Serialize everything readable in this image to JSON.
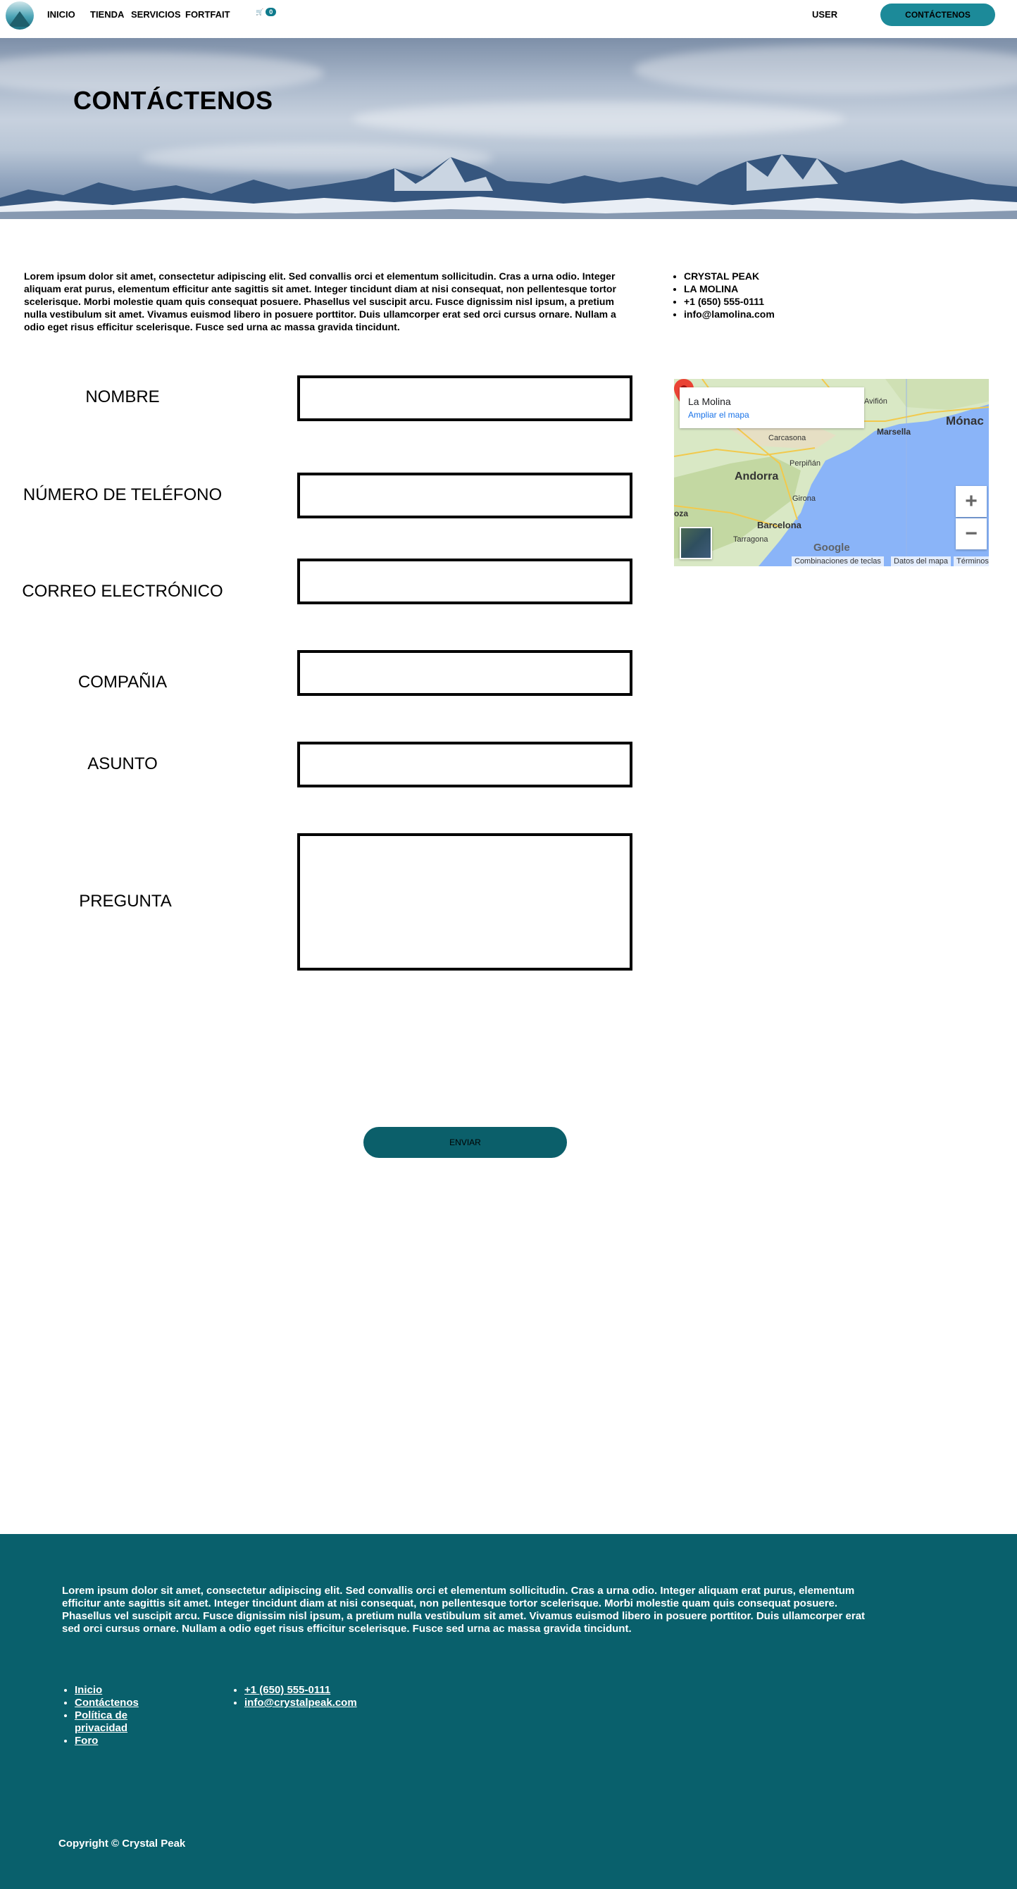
{
  "nav": {
    "links": [
      "INICIO",
      "TIENDA",
      "SERVICIOS",
      "FORTFAIT"
    ],
    "cart_count": "0",
    "user": "USER",
    "cta": "CONTÁCTENOS"
  },
  "hero": {
    "title": "CONTÁCTENOS"
  },
  "intro": {
    "text": "Lorem ipsum dolor sit amet, consectetur adipiscing elit. Sed convallis orci et elementum sollicitudin. Cras a urna odio. Integer aliquam erat purus, elementum efficitur ante sagittis sit amet. Integer tincidunt diam at nisi consequat, non pellentesque tortor scelerisque. Morbi molestie quam quis consequat posuere. Phasellus vel suscipit arcu. Fusce dignissim nisl ipsum, a pretium nulla vestibulum sit amet. Vivamus euismod libero in posuere porttitor. Duis ullamcorper erat sed orci cursus ornare. Nullam a odio eget risus efficitur scelerisque. Fusce sed urna ac massa gravida tincidunt."
  },
  "contact": [
    "CRYSTAL PEAK",
    "LA MOLINA",
    "+1 (650) 555-0111",
    "info@lamolina.com"
  ],
  "form": {
    "labels": [
      "NOMBRE",
      "NÚMERO DE TELÉFONO",
      "CORREO ELECTRÓNICO",
      "COMPAÑIA",
      "ASUNTO",
      "PREGUNTA"
    ],
    "submit": "ENVIAR"
  },
  "map": {
    "place": "La Molina",
    "enlarge": "Ampliar el mapa",
    "cities": [
      "Avifión",
      "Marsella",
      "Mónac",
      "Carcasona",
      "Perpiñán",
      "Andorra",
      "Girona",
      "oza",
      "Barcelona",
      "Tarragona"
    ],
    "google": "Google",
    "footer": [
      "Combinaciones de teclas",
      "Datos del mapa",
      "Términos"
    ]
  },
  "footer": {
    "text": "Lorem ipsum dolor sit amet, consectetur adipiscing elit. Sed convallis orci et elementum sollicitudin. Cras a urna odio. Integer aliquam erat purus, elementum efficitur ante sagittis sit amet. Integer tincidunt diam at nisi consequat, non pellentesque tortor scelerisque. Morbi molestie quam quis consequat posuere. Phasellus vel suscipit arcu. Fusce dignissim nisl ipsum, a pretium nulla vestibulum sit amet. Vivamus euismod libero in posuere porttitor. Duis ullamcorper erat sed orci cursus ornare. Nullam a odio eget risus efficitur scelerisque. Fusce sed urna ac massa gravida tincidunt.",
    "links": [
      "Inicio",
      "Contáctenos",
      "Política de privacidad",
      "Foro"
    ],
    "contact": [
      "+1 (650) 555-0111",
      "info@crystalpeak.com"
    ],
    "copyright": "Copyright © Crystal Peak"
  },
  "colors": {
    "accent": "#1c8a99",
    "footer_bg": "#09606c",
    "submit_bg": "#0b5f6a"
  }
}
